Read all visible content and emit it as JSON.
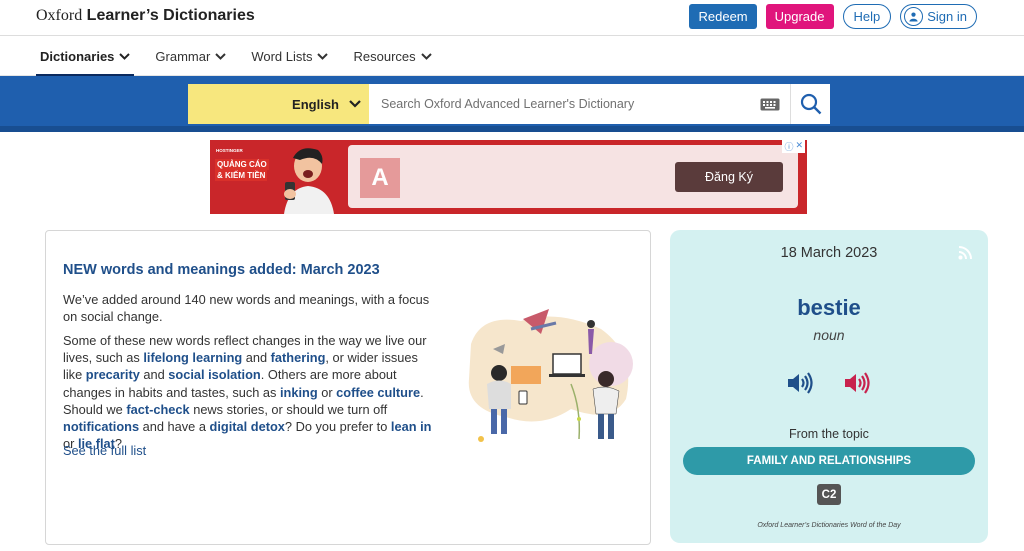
{
  "header": {
    "logo_prefix": "Oxford",
    "logo_main": "Learner’s Dictionaries",
    "redeem": "Redeem",
    "upgrade": "Upgrade",
    "help": "Help",
    "signin": "Sign in"
  },
  "nav": [
    {
      "label": "Dictionaries",
      "active": true
    },
    {
      "label": "Grammar"
    },
    {
      "label": "Word Lists"
    },
    {
      "label": "Resources"
    }
  ],
  "search": {
    "language": "English",
    "placeholder": "Search Oxford Advanced Learner's Dictionary"
  },
  "ad": {
    "badge": "HOSTINGER",
    "line1": "QUẢNG CÁO",
    "line2": "& KIẾM TIỀN",
    "logo_letter": "A",
    "cta": "Đăng Ký"
  },
  "news": {
    "title": "NEW words and meanings added: March 2023",
    "p1": "We’ve added around 140 new words and meanings, with a focus on social change.",
    "p2": {
      "t1": "Some of these new words reflect changes in the way we live our lives, such as ",
      "l1": "lifelong learning",
      "t2": " and ",
      "l2": "fathering",
      "t3": ", or wider issues like ",
      "l3": "precarity",
      "t4": " and ",
      "l4": "social isolation",
      "t5": ". Others are more about changes in habits and tastes, such as ",
      "l5": "inking",
      "t6": " or ",
      "l6": "coffee culture",
      "t7": ". Should we ",
      "l7": "fact-check",
      "t8": " news stories, or should we turn off ",
      "l8": "notifications",
      "t9": " and have a ",
      "l9": "digital detox",
      "t10": "? Do you prefer to ",
      "l10": "lean in",
      "t11": " or ",
      "l11": "lie flat",
      "t12": "?"
    },
    "see_all": "See the full list"
  },
  "wotd": {
    "date": "18 March 2023",
    "word": "bestie",
    "pos": "noun",
    "topic_label": "From the topic",
    "topic": "FAMILY AND RELATIONSHIPS",
    "level": "C2",
    "footer": "Oxford Learner’s Dictionaries Word of the Day"
  },
  "colors": {
    "brand_blue": "#1f5fae",
    "link": "#1f4f8a",
    "upgrade": "#e0157c",
    "wotd_bg": "#d4f1f1",
    "topic": "#2e9aa8",
    "lang_bg": "#f7e77e"
  }
}
